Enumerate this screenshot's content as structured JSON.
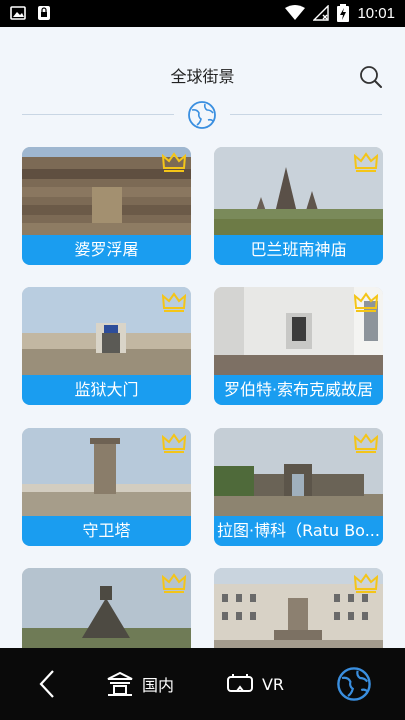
{
  "status_bar": {
    "time": "10:01"
  },
  "header": {
    "title": "全球街景"
  },
  "cards": [
    {
      "label": "婆罗浮屠"
    },
    {
      "label": "巴兰班南神庙"
    },
    {
      "label": "监狱大门"
    },
    {
      "label": "罗伯特·索布克威故居"
    },
    {
      "label": "守卫塔"
    },
    {
      "label": "拉图·博科（Ratu Bo..."
    },
    {
      "label": ""
    },
    {
      "label": ""
    }
  ],
  "bottom_nav": {
    "domestic_label": "国内",
    "vr_label": "VR"
  },
  "colors": {
    "accent": "#1a9df0",
    "crown": "#f4c518",
    "nav_bg": "#0a0a0a"
  }
}
